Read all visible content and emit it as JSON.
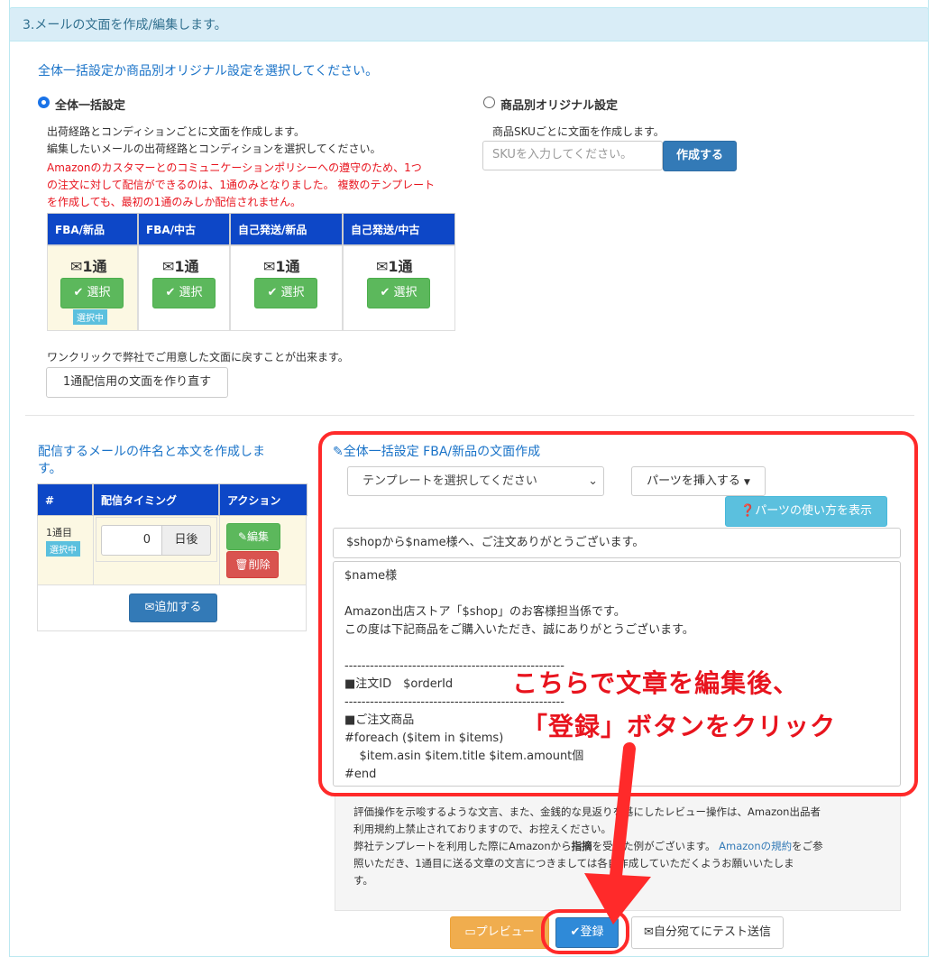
{
  "section": {
    "title": "3.メールの文面を作成/編集します。"
  },
  "setting_choice": {
    "heading": "全体一括設定か商品別オリジナル設定を選択してください。",
    "bulk": {
      "label": "全体一括設定",
      "desc1": "出荷経路とコンディションごとに文面を作成します。",
      "desc2": "編集したいメールの出荷経路とコンディションを選択してください。",
      "warning1": "Amazonのカスタマーとのコミュニケーションポリシーへの遵守のため、1つ",
      "warning2": "の注文に対して配信ができるのは、1通のみとなりました。 複数のテンプレート",
      "warning3": "を作成しても、最初の1通のみしか配信されません。"
    },
    "per_item": {
      "label": "商品別オリジナル設定",
      "desc": "商品SKUごとに文面を作成します。",
      "sku_placeholder": "SKUを入力してください。",
      "create_button": "作成する"
    }
  },
  "condition_table": {
    "headers": [
      "FBA/新品",
      "FBA/中古",
      "自己発送/新品",
      "自己発送/中古"
    ],
    "count_label": "1通",
    "select_label": "選択",
    "selected_badge": "選択中"
  },
  "reset": {
    "desc": "ワンクリックで弊社でご用意した文面に戻すことが出来ます。",
    "button": "1通配信用の文面を作り直す"
  },
  "schedule": {
    "heading": "配信するメールの件名と本文を作成しま",
    "heading2": "す。",
    "headers": [
      "#",
      "配信タイミング",
      "アクション"
    ],
    "row": {
      "index": "1通目",
      "badge": "選択中",
      "days_value": "0",
      "days_suffix": "日後",
      "edit": "編集",
      "delete": "削除"
    },
    "add_button": "追加する"
  },
  "editor": {
    "heading": "全体一括設定 FBA/新品の文面作成",
    "template_select": "テンプレートを選択してください",
    "insert_parts": "パーツを挿入する",
    "parts_help": "パーツの使い方を表示",
    "subject": "$shopから$name様へ、ご注文ありがとうございます。",
    "body": "$name様\n\nAmazon出店ストア「$shop」のお客様担当係です。\nこの度は下記商品をご購入いただき、誠にありがとうございます。\n\n----------------------------------------------------\n■注文ID　$orderId\n----------------------------------------------------\n■ご注文商品\n#foreach ($item in $items)\n    $item.asin $item.title $item.amount個\n#end"
  },
  "notice": {
    "line1": "評価操作を示唆するような文言、また、金銭的な見返りを基にしたレビュー操作は、Amazon出品者",
    "line2": "利用規約上禁止されておりますので、お控えください。",
    "line3a": "弊社テンプレートを利用した際にAmazonから",
    "line3b": "指摘",
    "line3c": "を受けた例がございます。",
    "link": "Amazonの規約",
    "line3d": "をご参",
    "line4": "照いただき、1通目に送る文章の文言につきましては各自作成していただくようお願いいたしま",
    "line5": "す。"
  },
  "actions": {
    "preview": "プレビュー",
    "register": "登録",
    "test_send": "自分宛てにテスト送信"
  },
  "annotation": {
    "line1": "こちらで文章を編集後、",
    "line2": "「登録」ボタンをクリック"
  },
  "colors": {
    "accent": "#337ab7",
    "table_header": "#0d47c7",
    "warning": "#e8141e",
    "callout": "#ff2a2a"
  }
}
